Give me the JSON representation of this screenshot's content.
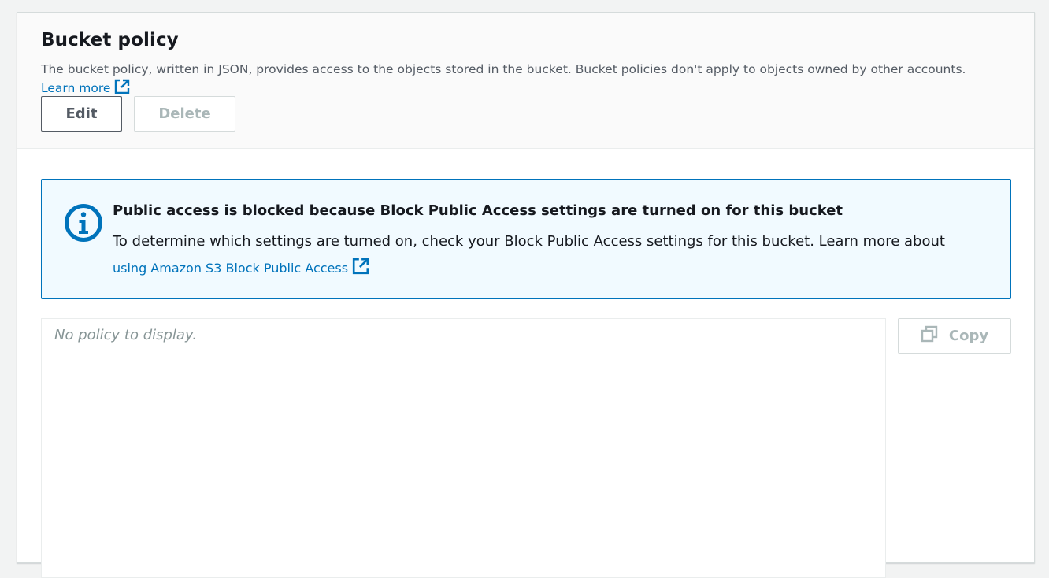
{
  "header": {
    "title": "Bucket policy",
    "description": "The bucket policy, written in JSON, provides access to the objects stored in the bucket. Bucket policies don't apply to objects owned by other accounts.",
    "learn_more": "Learn more",
    "learn_more_icon": "external-link-icon"
  },
  "actions": {
    "edit_label": "Edit",
    "delete_label": "Delete"
  },
  "alert": {
    "icon": "info-icon",
    "title": "Public access is blocked because Block Public Access settings are turned on for this bucket",
    "body": "To determine which settings are turned on, check your Block Public Access settings for this bucket. Learn more about",
    "link": "using Amazon S3 Block Public Access",
    "link_icon": "external-link-icon"
  },
  "policy": {
    "placeholder": "No policy to display.",
    "copy_label": "Copy",
    "copy_icon": "copy-icon"
  },
  "colors": {
    "link": "#0073bb",
    "alert_background": "#f1faff",
    "alert_border": "#0073bb",
    "header_background": "#fafafa",
    "disabled_text": "#aab7b8"
  }
}
